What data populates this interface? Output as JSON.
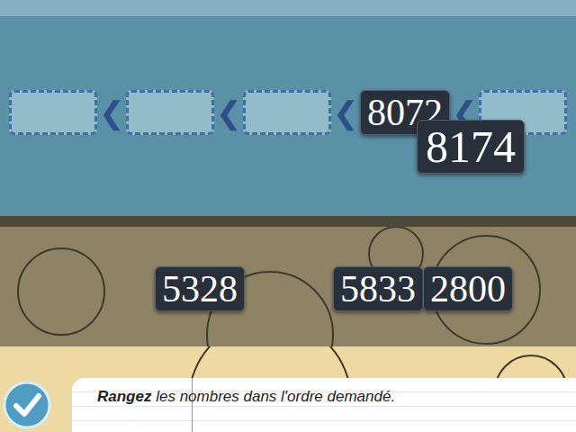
{
  "slots": [
    {
      "value": "",
      "filled": false
    },
    {
      "value": "",
      "filled": false
    },
    {
      "value": "",
      "filled": false
    },
    {
      "value": "8072",
      "filled": true
    },
    {
      "value": "",
      "filled": false
    }
  ],
  "separator": "❮",
  "dragged_tile": {
    "value": "8174"
  },
  "pool": [
    {
      "value": "5328"
    },
    {
      "value": "5833"
    },
    {
      "value": "2800"
    }
  ],
  "instruction": {
    "verb": "Rangez",
    "rest": " les nombres dans l'ordre demandé."
  }
}
